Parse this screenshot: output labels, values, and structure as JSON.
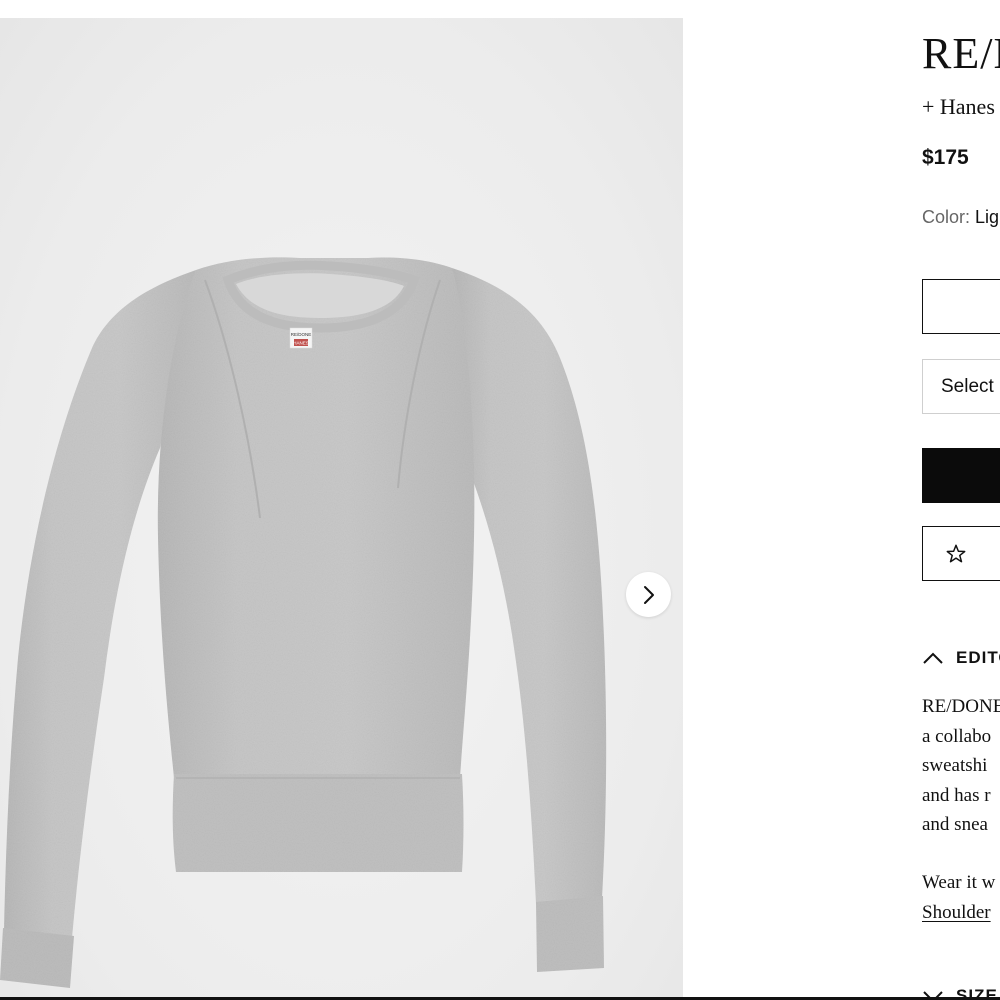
{
  "product": {
    "brand": "RE/DONE",
    "collaboration": "+ Hanes",
    "price": "$175",
    "color_label": "Color:",
    "color_value": "Light gray",
    "size_select_label": "Select",
    "editors_notes_title": "EDITORS' NOTES",
    "notes_lines": [
      "RE/DONE",
      "a collabo",
      "sweatshi",
      "and has r",
      "and snea"
    ],
    "wear_text": "Wear it w",
    "wear_link": "Shoulder",
    "size_fit_title": "SIZE"
  },
  "gallery": {
    "next_icon": "chevron-right-icon",
    "label_tag_line1": "RE/DONE",
    "label_tag_line2": "HANES"
  },
  "icons": {
    "wishlist": "star-icon",
    "collapse": "chevron-up-icon"
  },
  "colors": {
    "button_black": "#0b0b0b",
    "sweater": "#c4c4c4",
    "text": "#111111"
  }
}
